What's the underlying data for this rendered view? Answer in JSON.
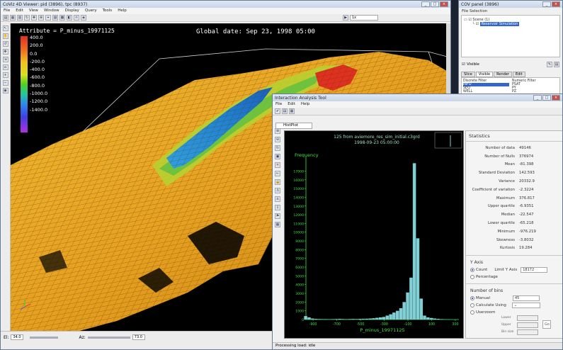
{
  "viewer": {
    "title": "CoViz 4D Viewer: pid (3896), tpc (8937)",
    "menu": [
      "File",
      "Edit",
      "View",
      "Window",
      "Display",
      "Query",
      "Tools",
      "Help"
    ],
    "combo_value": "1x",
    "attribute_label": "Attribute = P_minus_19971125",
    "global_date": "Global date: Sep 23, 1998 05:00",
    "legend_ticks": [
      "400.0",
      "200.0",
      "0.0",
      "-200.0",
      "-400.0",
      "-600.0",
      "-800.0",
      "-1000.0",
      "-1200.0",
      "-1400.0"
    ],
    "status": {
      "el_label": "El:",
      "el_value": "34.0",
      "az_label": "Az:",
      "az_value": "73.0"
    }
  },
  "cov_panel": {
    "title": "COV panel (3896)",
    "file_selection_label": "File Selection",
    "tree": {
      "scene": "Scene (1)",
      "item": "Reservoir Simulation"
    },
    "visible_label": "Visible",
    "tabs": [
      "Slice",
      "Visible",
      "Render",
      "Edit"
    ],
    "discrete_filter_label": "Discrete Filter",
    "numeric_filter_label": "Numeric Filter",
    "discrete_items": [
      "INFO",
      "SEQ",
      "WELL"
    ],
    "numeric_items": [
      "PSAT",
      "PY",
      "PZ"
    ]
  },
  "iat": {
    "title": "Interaction Analysis Tool",
    "menu": [
      "File",
      "Edit",
      "Help"
    ],
    "tab_label": "HistPlot",
    "status": "Processing load: idle",
    "plot_title_1": "125 from aviemore_res_sim_initial.c3grd",
    "plot_title_2": "1998-09-23 05:00:00",
    "stats_title": "Statistics",
    "stats": [
      {
        "k": "Number of data",
        "v": "49146"
      },
      {
        "k": "Number of Nulls",
        "v": "376974"
      },
      {
        "k": "Mean",
        "v": "-81.398"
      },
      {
        "k": "Standard Deviation",
        "v": "142.593"
      },
      {
        "k": "Variance",
        "v": "20332.9"
      },
      {
        "k": "Coefficient of variation",
        "v": "-2.3224"
      },
      {
        "k": "Maximum",
        "v": "376.817"
      },
      {
        "k": "Upper quartile",
        "v": "-6.9351"
      },
      {
        "k": "Median",
        "v": "-22.547"
      },
      {
        "k": "Lower quartile",
        "v": "-65.218"
      },
      {
        "k": "Minimum",
        "v": "-976.219"
      },
      {
        "k": "Skewness",
        "v": "-3.8032"
      },
      {
        "k": "Kurtosis",
        "v": "19.284"
      }
    ],
    "yaxis": {
      "title": "Y Axis",
      "count_label": "Count",
      "limit_label": "Limit Y Axis",
      "limit_value": "18172",
      "percentage_label": "Percentage"
    },
    "bins": {
      "title": "Number of bins",
      "manual_label": "Manual",
      "manual_value": "45",
      "calc_label": "Calculate Using",
      "userzoom_label": "Userzoom",
      "lower_label": "Lower",
      "upper_label": "Upper",
      "binsize_label": "Bin size",
      "go_label": "Go"
    }
  },
  "chart_data": {
    "type": "bar",
    "ylabel": "Frequency",
    "xlabel": "P_minus_19971125",
    "xlim": [
      -960,
      330
    ],
    "ylim": [
      0,
      18172
    ],
    "x_ticks": [
      -900,
      -700,
      -500,
      -300,
      -100,
      100,
      300
    ],
    "y_ticks": [
      0,
      1000,
      2000,
      3000,
      4000,
      5000,
      6000,
      7000,
      8000,
      9000,
      10000,
      11000,
      12000,
      13000,
      14000,
      15000,
      16000,
      17000
    ],
    "bin_width": 28.7,
    "bin_starts": [
      -976,
      -947,
      -919,
      -890,
      -861,
      -833,
      -804,
      -775,
      -747,
      -718,
      -689,
      -661,
      -632,
      -603,
      -575,
      -546,
      -517,
      -489,
      -460,
      -431,
      -403,
      -374,
      -345,
      -317,
      -288,
      -259,
      -231,
      -202,
      -173,
      -145,
      -116,
      -87,
      -59,
      -30,
      -1,
      27,
      56,
      85,
      113,
      142,
      171,
      199,
      228,
      257,
      285
    ],
    "values": [
      400,
      250,
      120,
      80,
      60,
      50,
      50,
      40,
      50,
      60,
      80,
      60,
      50,
      60,
      70,
      60,
      80,
      90,
      100,
      120,
      150,
      200,
      250,
      300,
      450,
      600,
      800,
      1000,
      1300,
      2000,
      3100,
      4800,
      17900,
      9300,
      2400,
      450,
      250,
      180,
      120,
      80,
      50,
      30,
      20,
      10,
      5
    ],
    "bar_color": "#7fcfd4"
  }
}
